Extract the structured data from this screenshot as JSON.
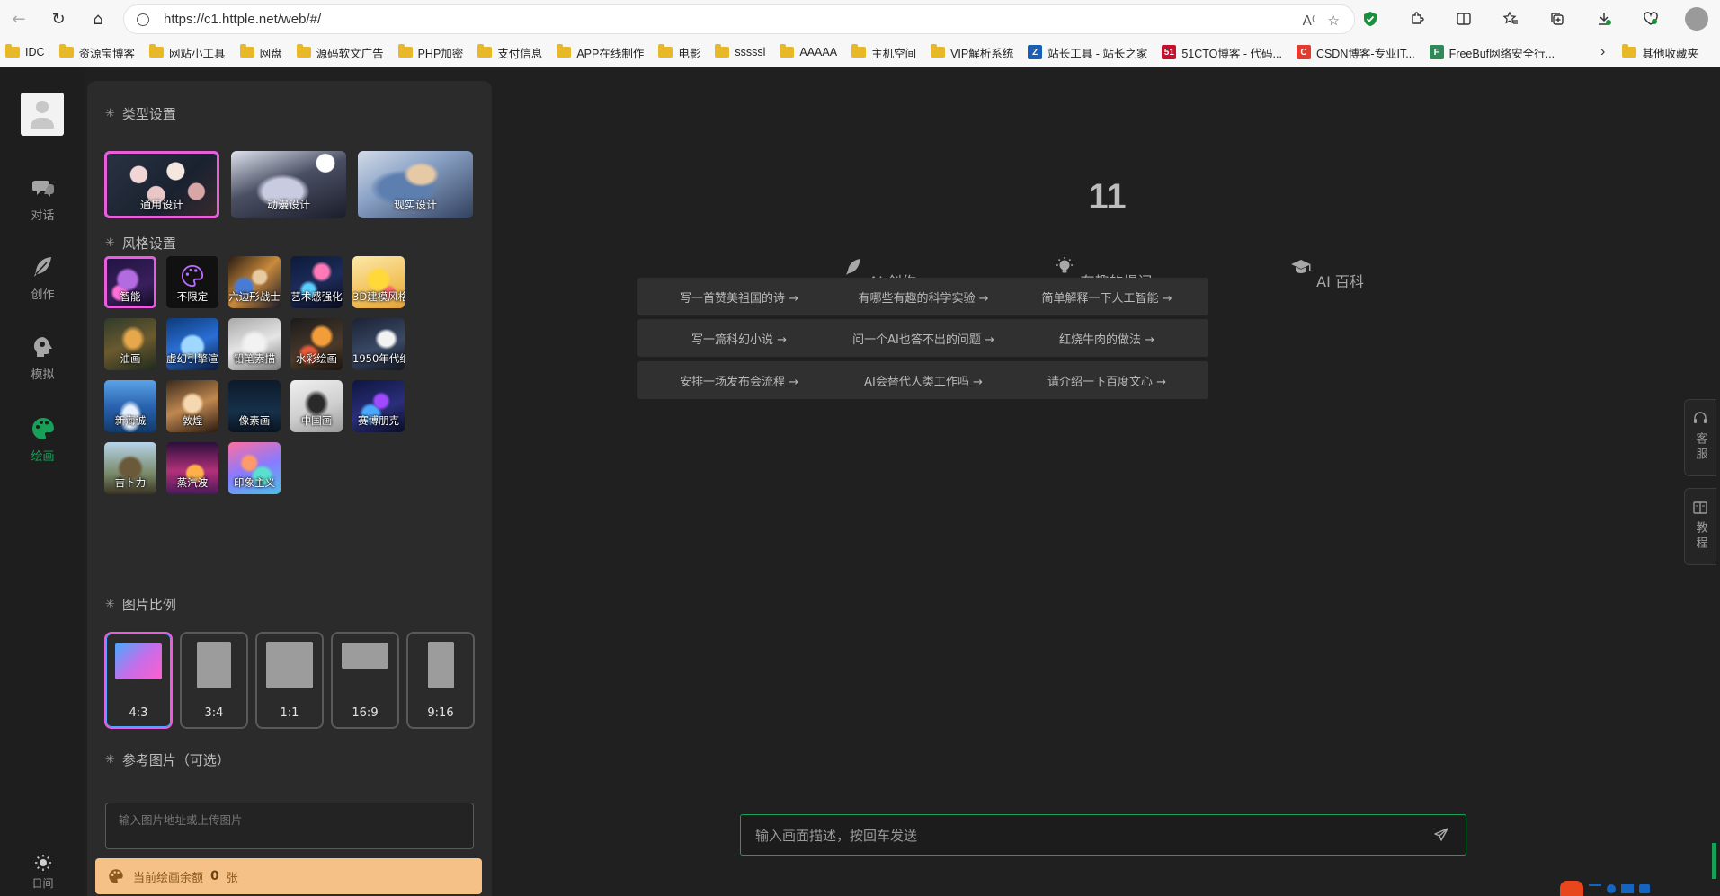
{
  "browser": {
    "url": "https://c1.httple.net/web/#/",
    "bookmarks": [
      "IDC",
      "资源宝博客",
      "网站小工具",
      "网盘",
      "源码软文广告",
      "PHP加密",
      "支付信息",
      "APP在线制作",
      "电影",
      "sssssl",
      "AAAAA",
      "主机空间",
      "VIP解析系统",
      "站长工具 - 站长之家",
      "51CTO博客 - 代码...",
      "CSDN博客-专业IT...",
      "FreeBuf网络安全行..."
    ],
    "other_bookmarks": "其他收藏夹"
  },
  "rail": {
    "items": [
      {
        "label": "对话"
      },
      {
        "label": "创作"
      },
      {
        "label": "模拟"
      },
      {
        "label": "绘画"
      }
    ],
    "theme_label": "日间",
    "active_color": "#18a058"
  },
  "panel": {
    "type_title": "类型设置",
    "types": [
      "通用设计",
      "动漫设计",
      "现实设计"
    ],
    "style_title": "风格设置",
    "styles": [
      "智能",
      "不限定",
      "六边形战士",
      "艺术感强化",
      "3D建模风格",
      "油画",
      "虚幻引擎渲染",
      "铅笔素描",
      "水彩绘画",
      "1950年代纸张",
      "新海诚",
      "敦煌",
      "像素画",
      "中国画",
      "赛博朋克",
      "吉卜力",
      "蒸汽波",
      "印象主义"
    ],
    "ratio_title": "图片比例",
    "ratios": [
      "4:3",
      "3:4",
      "1:1",
      "16:9",
      "9:16"
    ],
    "ref_title": "参考图片（可选）",
    "ref_placeholder": "输入图片地址或上传图片",
    "balance_prefix": "当前绘画余额",
    "balance_value": "0",
    "balance_unit": "张"
  },
  "main": {
    "title": "11",
    "columns": [
      {
        "head": "AI 创作",
        "prompts": [
          "写一首赞美祖国的诗 →",
          "写一篇科幻小说 →",
          "安排一场发布会流程 →"
        ]
      },
      {
        "head": "有趣的提问",
        "prompts": [
          "有哪些有趣的科学实验 →",
          "问一个AI也答不出的问题 →",
          "AI会替代人类工作吗 →"
        ]
      },
      {
        "head": "AI 百科",
        "prompts": [
          "简单解释一下人工智能 →",
          "红烧牛肉的做法 →",
          "请介绍一下百度文心 →"
        ]
      }
    ],
    "input_placeholder": "输入画面描述，按回车发送",
    "side_service": "客服",
    "side_tutorial": "教程"
  }
}
